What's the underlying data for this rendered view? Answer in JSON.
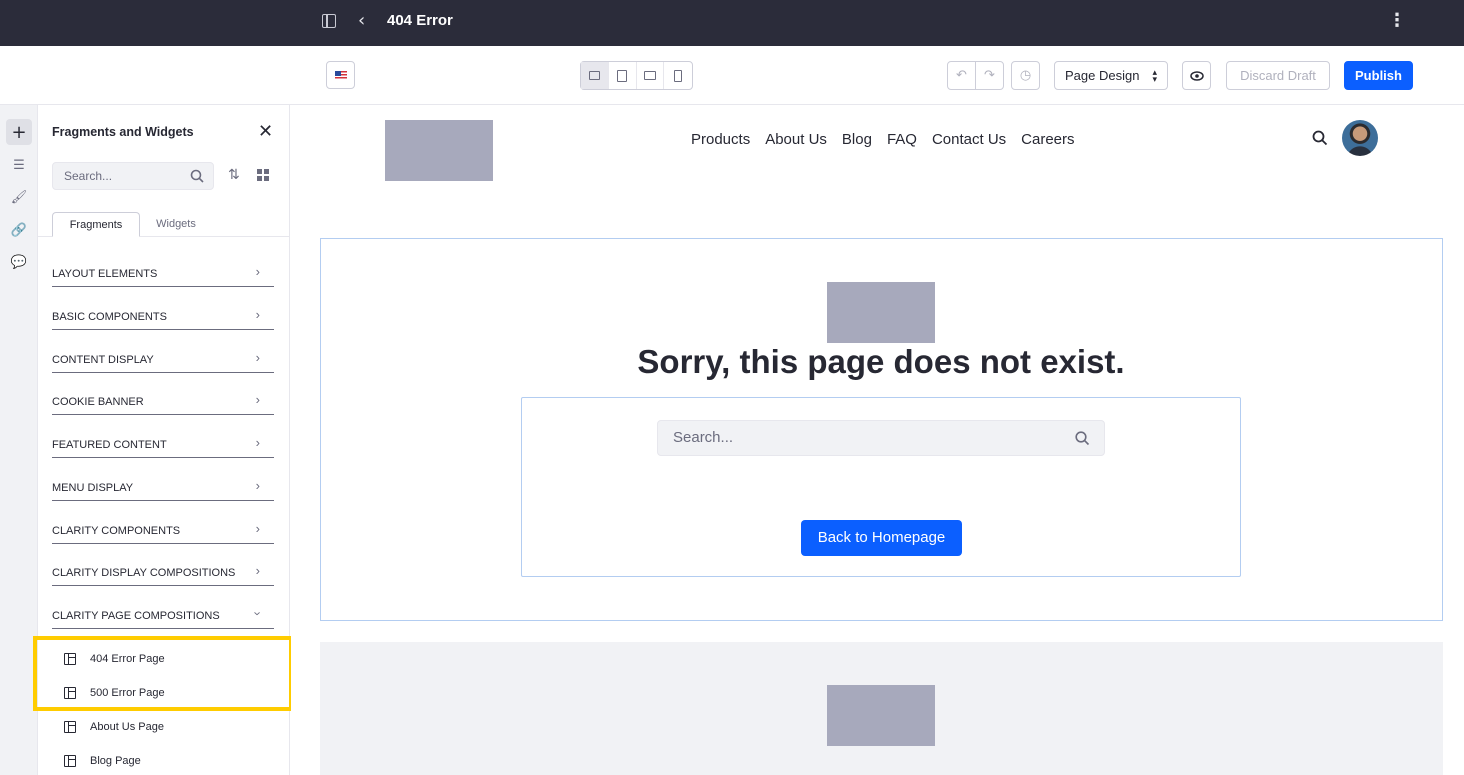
{
  "topbar": {
    "title": "404 Error",
    "back_label": "‹",
    "kebab": "⋮"
  },
  "toolbar": {
    "page_design_label": "Page Design",
    "discard_label": "Discard Draft",
    "publish_label": "Publish"
  },
  "panel": {
    "title": "Fragments and Widgets",
    "search_placeholder": "Search...",
    "tabs": [
      "Fragments",
      "Widgets"
    ],
    "categories": [
      "LAYOUT ELEMENTS",
      "BASIC COMPONENTS",
      "CONTENT DISPLAY",
      "COOKIE BANNER",
      "FEATURED CONTENT",
      "MENU DISPLAY",
      "CLARITY COMPONENTS",
      "CLARITY DISPLAY COMPOSITIONS",
      "CLARITY PAGE COMPOSITIONS"
    ],
    "items": [
      "404 Error Page",
      "500 Error Page",
      "About Us Page",
      "Blog Page"
    ]
  },
  "site": {
    "nav": [
      "Products",
      "About Us",
      "Blog",
      "FAQ",
      "Contact Us",
      "Careers"
    ],
    "error_title": "Sorry, this page does not exist.",
    "search_placeholder": "Search...",
    "back_button": "Back to Homepage"
  },
  "colors": {
    "accent": "#0b5fff",
    "highlight": "#ffcc00",
    "topbar": "#2b2c3a"
  }
}
